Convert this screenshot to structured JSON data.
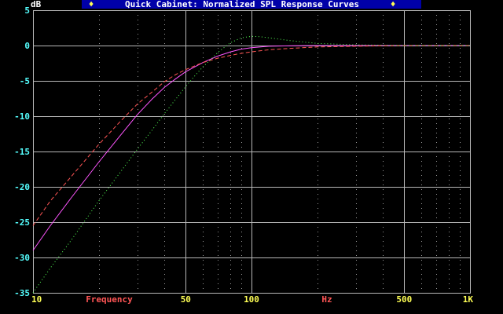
{
  "window": {
    "title_bar_text": "Quick Cabinet: Normalized SPL Response Curves",
    "title_marker_left": "♦",
    "title_marker_right": "♦"
  },
  "colors": {
    "background": "#000000",
    "title_bar": "#0000a8",
    "title_text": "#ffffff",
    "title_marker": "#ffff55",
    "grid_major": "#b8b8b8",
    "grid_minor": "#9a9a9a",
    "y_tick_label": "#55ffff",
    "x_tick_label": "#ffff55",
    "x_axis_label": "#ff5555",
    "ylabel": "#ffffff"
  },
  "chart_data": {
    "type": "line",
    "title": "Quick Cabinet: Normalized SPL Response Curves",
    "xlabel": "Frequency",
    "x_unit_label": "Hz",
    "ylabel": "dB",
    "xscale": "log",
    "xlim": [
      10,
      1000
    ],
    "ylim": [
      -35,
      5
    ],
    "grid": true,
    "legend": "none",
    "y_ticks": [
      {
        "value": 5,
        "label": "5"
      },
      {
        "value": 0,
        "label": "0"
      },
      {
        "value": -5,
        "label": "-5"
      },
      {
        "value": -10,
        "label": "-10"
      },
      {
        "value": -15,
        "label": "-15"
      },
      {
        "value": -20,
        "label": "-20"
      },
      {
        "value": -25,
        "label": "-25"
      },
      {
        "value": -30,
        "label": "-30"
      },
      {
        "value": -35,
        "label": "-35"
      }
    ],
    "x_ticks": [
      {
        "value": 10,
        "label": "10"
      },
      {
        "value": 50,
        "label": "50"
      },
      {
        "value": 100,
        "label": "100"
      },
      {
        "value": 500,
        "label": "500"
      },
      {
        "value": 1000,
        "label": "1K"
      }
    ],
    "series": [
      {
        "style": "solid",
        "color": "#ff55ff",
        "x": [
          10,
          12,
          15,
          20,
          25,
          30,
          35,
          40,
          45,
          50,
          60,
          70,
          80,
          90,
          100,
          120,
          150,
          200,
          300,
          500,
          700,
          1000
        ],
        "y": [
          -29.0,
          -25.5,
          -21.5,
          -16.5,
          -12.8,
          -9.8,
          -7.6,
          -5.9,
          -4.7,
          -3.7,
          -2.4,
          -1.5,
          -0.9,
          -0.5,
          -0.3,
          -0.1,
          -0.05,
          0,
          0,
          0,
          0,
          0
        ]
      },
      {
        "style": "dashed",
        "color": "#ff5555",
        "x": [
          10,
          12,
          15,
          20,
          25,
          30,
          35,
          40,
          45,
          50,
          60,
          70,
          80,
          90,
          100,
          120,
          150,
          200,
          300,
          500,
          700,
          1000
        ],
        "y": [
          -25.5,
          -22.0,
          -18.5,
          -14.0,
          -10.8,
          -8.3,
          -6.6,
          -5.1,
          -4.1,
          -3.4,
          -2.4,
          -1.8,
          -1.4,
          -1.1,
          -0.9,
          -0.6,
          -0.4,
          -0.2,
          -0.1,
          0,
          0,
          0
        ]
      },
      {
        "style": "dotted",
        "color": "#55ff55",
        "x": [
          10,
          12,
          15,
          20,
          25,
          30,
          35,
          40,
          45,
          50,
          55,
          60,
          65,
          70,
          80,
          90,
          100,
          110,
          120,
          150,
          200,
          300,
          500,
          700,
          1000
        ],
        "y": [
          -35.0,
          -31.5,
          -27.5,
          -22.0,
          -18.0,
          -14.7,
          -12.0,
          -9.6,
          -7.6,
          -5.8,
          -4.3,
          -3.0,
          -2.0,
          -1.0,
          0.4,
          1.1,
          1.3,
          1.25,
          1.1,
          0.7,
          0.3,
          0.1,
          0,
          0,
          0
        ]
      }
    ]
  }
}
